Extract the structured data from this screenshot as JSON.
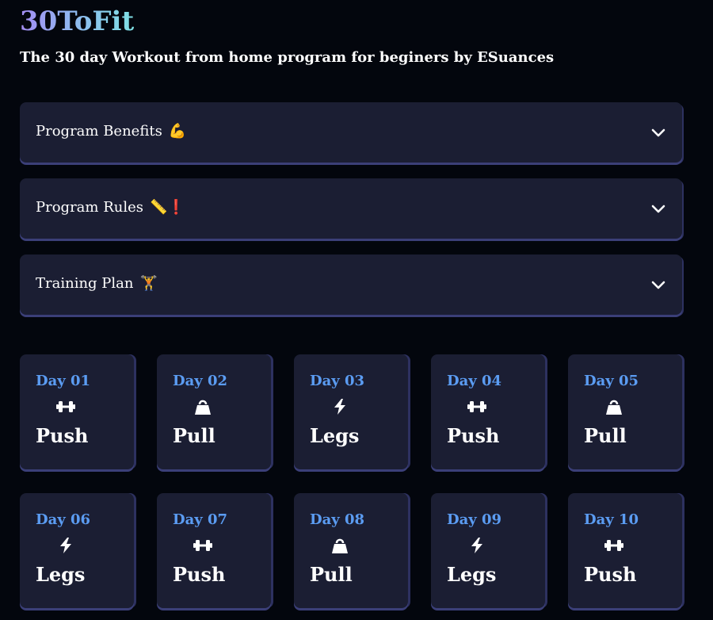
{
  "header": {
    "brand": "30ToFit",
    "subtitle": "The 30 day Workout from home program for beginers by ESuances"
  },
  "accordions": [
    {
      "label": "Program Benefits",
      "emoji": "💪"
    },
    {
      "label": "Program Rules",
      "emoji": "📏❗"
    },
    {
      "label": "Training Plan",
      "emoji": "🏋"
    }
  ],
  "days": [
    {
      "day": "Day 01",
      "type": "Push",
      "icon": "dumbbell-icon"
    },
    {
      "day": "Day 02",
      "type": "Pull",
      "icon": "kettlebell-icon"
    },
    {
      "day": "Day 03",
      "type": "Legs",
      "icon": "bolt-icon"
    },
    {
      "day": "Day 04",
      "type": "Push",
      "icon": "dumbbell-icon"
    },
    {
      "day": "Day 05",
      "type": "Pull",
      "icon": "kettlebell-icon"
    },
    {
      "day": "Day 06",
      "type": "Legs",
      "icon": "bolt-icon"
    },
    {
      "day": "Day 07",
      "type": "Push",
      "icon": "dumbbell-icon"
    },
    {
      "day": "Day 08",
      "type": "Pull",
      "icon": "kettlebell-icon"
    },
    {
      "day": "Day 09",
      "type": "Legs",
      "icon": "bolt-icon"
    },
    {
      "day": "Day 10",
      "type": "Push",
      "icon": "dumbbell-icon"
    }
  ],
  "colors": {
    "background": "#03060d",
    "card": "#1b1e33",
    "card_shadow": "#3b3f78",
    "day_label": "#5b9cf2",
    "text": "#ffffff"
  }
}
